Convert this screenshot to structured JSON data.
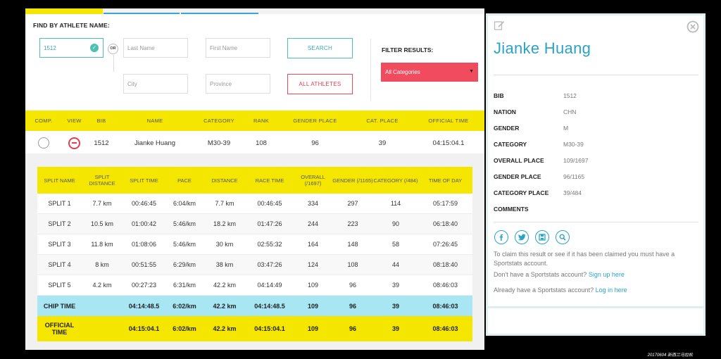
{
  "search": {
    "find_label": "FIND BY ATHLETE NAME:",
    "bib_value": "1512",
    "or_label": "OR",
    "last_name_placeholder": "Last Name",
    "first_name_placeholder": "First Name",
    "city_placeholder": "City",
    "province_placeholder": "Province",
    "search_button": "SEARCH",
    "all_athletes_button": "ALL ATHLETES",
    "filter_label": "FILTER RESULTS:",
    "category_select": "All Categories"
  },
  "results": {
    "headers": [
      "COMP.",
      "VIEW",
      "BIB",
      "NAME",
      "CATEGORY",
      "RANK",
      "GENDER PLACE",
      "CAT. PLACE",
      "OFFICIAL TIME"
    ],
    "row": {
      "bib": "1512",
      "name": "Jianke Huang",
      "category": "M30-39",
      "rank": "108",
      "gender_place": "96",
      "cat_place": "39",
      "official_time": "04:15:04.1"
    }
  },
  "splits": {
    "headers": [
      "SPLIT NAME",
      "SPLIT DISTANCE",
      "SPLIT TIME",
      "PACE",
      "DISTANCE",
      "RACE TIME",
      "OVERALL (/1697)",
      "GENDER (/1165)",
      "CATEGORY (/484)",
      "TIME OF DAY"
    ],
    "rows": [
      [
        "SPLIT 1",
        "7.7 km",
        "00:46:45",
        "6:04/km",
        "7.7 km",
        "00:46:45",
        "334",
        "297",
        "114",
        "05:17:59"
      ],
      [
        "SPLIT 2",
        "10.5 km",
        "01:00:42",
        "5:46/km",
        "18.2 km",
        "01:47:26",
        "244",
        "223",
        "90",
        "06:18:40"
      ],
      [
        "SPLIT 3",
        "11.8 km",
        "01:08:06",
        "5:46/km",
        "30 km",
        "02:55:32",
        "164",
        "148",
        "58",
        "07:26:45"
      ],
      [
        "SPLIT 4",
        "8 km",
        "00:51:55",
        "6:29/km",
        "38 km",
        "03:47:26",
        "124",
        "108",
        "44",
        "08:18:40"
      ],
      [
        "SPLIT 5",
        "4.2 km",
        "00:27:23",
        "6:31/km",
        "42.2 km",
        "04:14:49",
        "109",
        "96",
        "39",
        "08:46:03"
      ]
    ],
    "chip": [
      "CHIP TIME",
      "",
      "04:14:48.5",
      "6:02/km",
      "42.2 km",
      "04:14:48.5",
      "109",
      "96",
      "39",
      "08:46:03"
    ],
    "official": [
      "OFFICIAL TIME",
      "",
      "04:15:04.1",
      "6:02/km",
      "42.2 km",
      "04:15:04.1",
      "109",
      "96",
      "39",
      "08:46:03"
    ]
  },
  "profile": {
    "name": "Jianke Huang",
    "details": [
      {
        "label": "BIB",
        "value": "1512"
      },
      {
        "label": "NATION",
        "value": "CHN"
      },
      {
        "label": "GENDER",
        "value": "M"
      },
      {
        "label": "CATEGORY",
        "value": "M30-39"
      },
      {
        "label": "OVERALL PLACE",
        "value": "109/1697"
      },
      {
        "label": "GENDER PLACE",
        "value": "96/1165"
      },
      {
        "label": "CATEGORY PLACE",
        "value": "39/484"
      },
      {
        "label": "COMMENTS",
        "value": ""
      }
    ],
    "claim_text": "To claim this result or see if it has been claimed you must have a Sportstats account.",
    "no_account_text": "Don't have a Sportstats account?",
    "sign_up_link": "Sign up here",
    "have_account_text": "Already have a Sportstats account?",
    "log_in_link": "Log in here",
    "social_icons": [
      "facebook-icon",
      "twitter-icon",
      "save-icon",
      "search-icon"
    ]
  },
  "watermark": "20170604 新西兰马拉松",
  "colors": {
    "yellow": "#f5e600",
    "teal": "#4cc0b4",
    "red": "#f04b5e",
    "link_blue": "#2aa3c9",
    "chip_blue": "#a8e6f3"
  }
}
